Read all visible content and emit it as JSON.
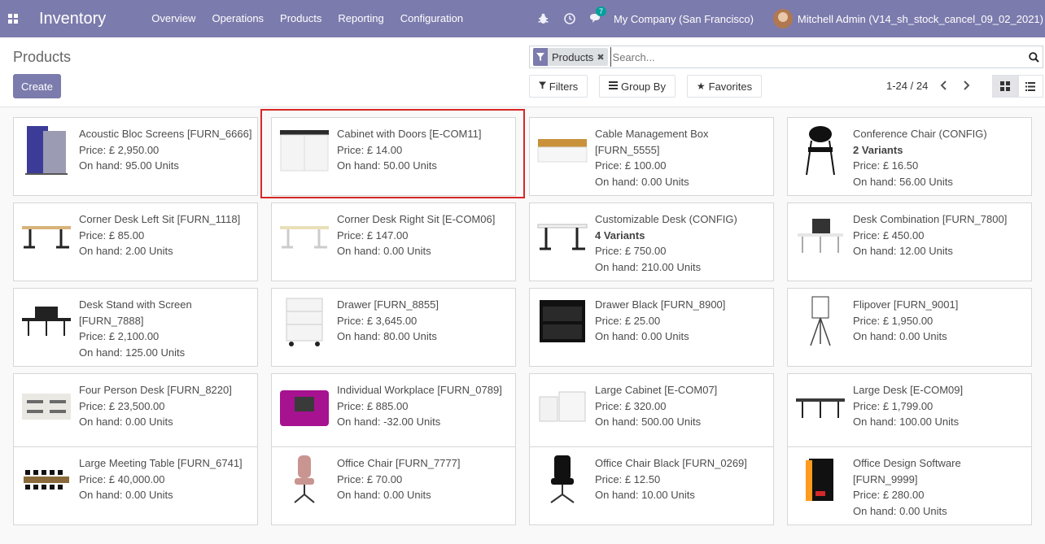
{
  "navbar": {
    "brand": "Inventory",
    "menu": [
      "Overview",
      "Operations",
      "Products",
      "Reporting",
      "Configuration"
    ],
    "chat_count": "7",
    "company": "My Company (San Francisco)",
    "user": "Mitchell Admin (V14_sh_stock_cancel_09_02_2021)"
  },
  "control": {
    "title": "Products",
    "create_label": "Create",
    "facet_label": "Products",
    "search_placeholder": "Search...",
    "filters_label": "Filters",
    "groupby_label": "Group By",
    "favorites_label": "Favorites",
    "pager": "1-24 / 24"
  },
  "products": [
    {
      "name": "Acoustic Bloc Screens [FURN_6666]",
      "price": "Price: £ 2,950.00",
      "onhand": "On hand: 95.00 Units",
      "icon": "acoustic-screen"
    },
    {
      "name": "Cabinet with Doors [E-COM11]",
      "price": "Price: £ 14.00",
      "onhand": "On hand: 50.00 Units",
      "icon": "cabinet"
    },
    {
      "name": "Cable Management Box [FURN_5555]",
      "price": "Price: £ 100.00",
      "onhand": "On hand: 0.00 Units",
      "icon": "cable-box"
    },
    {
      "name": "Conference Chair (CONFIG)",
      "variants": "2 Variants",
      "price": "Price: £ 16.50",
      "onhand": "On hand: 56.00 Units",
      "icon": "chair"
    },
    {
      "name": "Corner Desk Left Sit [FURN_1118]",
      "price": "Price: £ 85.00",
      "onhand": "On hand: 2.00 Units",
      "icon": "desk"
    },
    {
      "name": "Corner Desk Right Sit [E-COM06]",
      "price": "Price: £ 147.00",
      "onhand": "On hand: 0.00 Units",
      "icon": "desk-light"
    },
    {
      "name": "Customizable Desk (CONFIG)",
      "variants": "4 Variants",
      "price": "Price: £ 750.00",
      "onhand": "On hand: 210.00 Units",
      "icon": "desk-white"
    },
    {
      "name": "Desk Combination [FURN_7800]",
      "price": "Price: £ 450.00",
      "onhand": "On hand: 12.00 Units",
      "icon": "desk-combo"
    },
    {
      "name": "Desk Stand with Screen [FURN_7888]",
      "price": "Price: £ 2,100.00",
      "onhand": "On hand: 125.00 Units",
      "icon": "desk-screen"
    },
    {
      "name": "Drawer [FURN_8855]",
      "price": "Price: £ 3,645.00",
      "onhand": "On hand: 80.00 Units",
      "icon": "drawer"
    },
    {
      "name": "Drawer Black [FURN_8900]",
      "price": "Price: £ 25.00",
      "onhand": "On hand: 0.00 Units",
      "icon": "drawer-black"
    },
    {
      "name": "Flipover [FURN_9001]",
      "price": "Price: £ 1,950.00",
      "onhand": "On hand: 0.00 Units",
      "icon": "flipover"
    },
    {
      "name": "Four Person Desk [FURN_8220]",
      "price": "Price: £ 23,500.00",
      "onhand": "On hand: 0.00 Units",
      "icon": "four-desk"
    },
    {
      "name": "Individual Workplace [FURN_0789]",
      "price": "Price: £ 885.00",
      "onhand": "On hand: -32.00 Units",
      "icon": "workplace"
    },
    {
      "name": "Large Cabinet [E-COM07]",
      "price": "Price: £ 320.00",
      "onhand": "On hand: 500.00 Units",
      "icon": "large-cabinet"
    },
    {
      "name": "Large Desk [E-COM09]",
      "price": "Price: £ 1,799.00",
      "onhand": "On hand: 100.00 Units",
      "icon": "large-desk"
    },
    {
      "name": "Large Meeting Table [FURN_6741]",
      "price": "Price: £ 40,000.00",
      "onhand": "On hand: 0.00 Units",
      "icon": "meeting-table"
    },
    {
      "name": "Office Chair [FURN_7777]",
      "price": "Price: £ 70.00",
      "onhand": "On hand: 0.00 Units",
      "icon": "office-chair"
    },
    {
      "name": "Office Chair Black [FURN_0269]",
      "price": "Price: £ 12.50",
      "onhand": "On hand: 10.00 Units",
      "icon": "office-chair-black"
    },
    {
      "name": "Office Design Software [FURN_9999]",
      "price": "Price: £ 280.00",
      "onhand": "On hand: 0.00 Units",
      "icon": "software-box"
    }
  ]
}
